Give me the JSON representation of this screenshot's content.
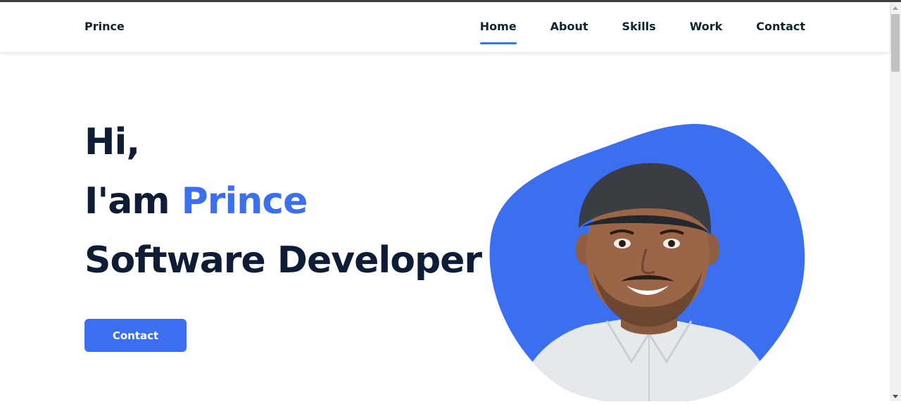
{
  "brand": {
    "name": "Prince"
  },
  "nav": {
    "items": [
      {
        "label": "Home",
        "active": true
      },
      {
        "label": "About",
        "active": false
      },
      {
        "label": "Skills",
        "active": false
      },
      {
        "label": "Work",
        "active": false
      },
      {
        "label": "Contact",
        "active": false
      }
    ]
  },
  "hero": {
    "line1": "Hi,",
    "line2_prefix": "I'am ",
    "line2_name": "Prince",
    "line3": "Software Developer",
    "button_label": "Contact"
  },
  "colors": {
    "accent": "#3c6ef0",
    "text_dark": "#0e1d35",
    "nav_text": "#0e2431",
    "background": "#ffffff"
  },
  "icons": {
    "profile": "profile-photo"
  }
}
